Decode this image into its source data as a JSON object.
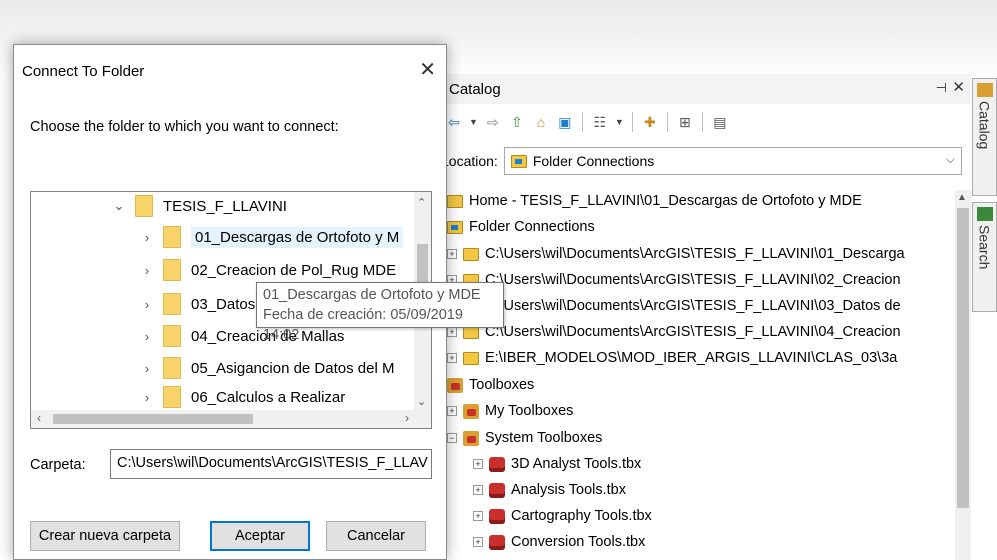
{
  "catalog": {
    "title": "Catalog",
    "pin_glyph": "ᴾ",
    "close_glyph": "✕",
    "location_label": "Location:",
    "location_value": "Folder Connections",
    "tree": [
      {
        "label": "Home - TESIS_F_LLAVINI\\01_Descargas de Ortofoto y MDE"
      },
      {
        "label": "Folder Connections"
      },
      {
        "label": "C:\\Users\\wil\\Documents\\ArcGIS\\TESIS_F_LLAVINI\\01_Descarga"
      },
      {
        "label": "C:\\Users\\wil\\Documents\\ArcGIS\\TESIS_F_LLAVINI\\02_Creacion"
      },
      {
        "label": "C:\\Users\\wil\\Documents\\ArcGIS\\TESIS_F_LLAVINI\\03_Datos de"
      },
      {
        "label": "C:\\Users\\wil\\Documents\\ArcGIS\\TESIS_F_LLAVINI\\04_Creacion"
      },
      {
        "label": "E:\\IBER_MODELOS\\MOD_IBER_ARGIS_LLAVINI\\CLAS_03\\3a"
      },
      {
        "label": "Toolboxes"
      },
      {
        "label": "My Toolboxes"
      },
      {
        "label": "System Toolboxes"
      },
      {
        "label": "3D Analyst Tools.tbx"
      },
      {
        "label": "Analysis Tools.tbx"
      },
      {
        "label": "Cartography Tools.tbx"
      },
      {
        "label": "Conversion Tools.tbx"
      }
    ]
  },
  "dock": {
    "catalog_tab": "Catalog",
    "search_tab": "Search"
  },
  "dialog": {
    "title": "Connect To Folder",
    "close_glyph": "✕",
    "prompt": "Choose the folder to which you want to connect:",
    "tree": [
      {
        "label": "TESIS_F_LLAVINI",
        "chevron": "⌄"
      },
      {
        "label": "01_Descargas de Ortofoto y M",
        "chevron": "›"
      },
      {
        "label": "02_Creacion de Pol_Rug MDE",
        "chevron": "›"
      },
      {
        "label": "03_Datos",
        "chevron": "›"
      },
      {
        "label": "04_Creacion de Mallas",
        "chevron": "›"
      },
      {
        "label": "05_Asigancion de Datos del M",
        "chevron": "›"
      },
      {
        "label": "06_Calculos a Realizar",
        "chevron": "›"
      }
    ],
    "tooltip": {
      "line1": "01_Descargas de Ortofoto y MDE",
      "line2": "Fecha de creación: 05/09/2019 14:02"
    },
    "carpeta_label": "Carpeta:",
    "carpeta_value": "C:\\Users\\wil\\Documents\\ArcGIS\\TESIS_F_LLAV",
    "buttons": {
      "new_folder": "Crear nueva carpeta",
      "ok": "Aceptar",
      "cancel": "Cancelar"
    }
  }
}
